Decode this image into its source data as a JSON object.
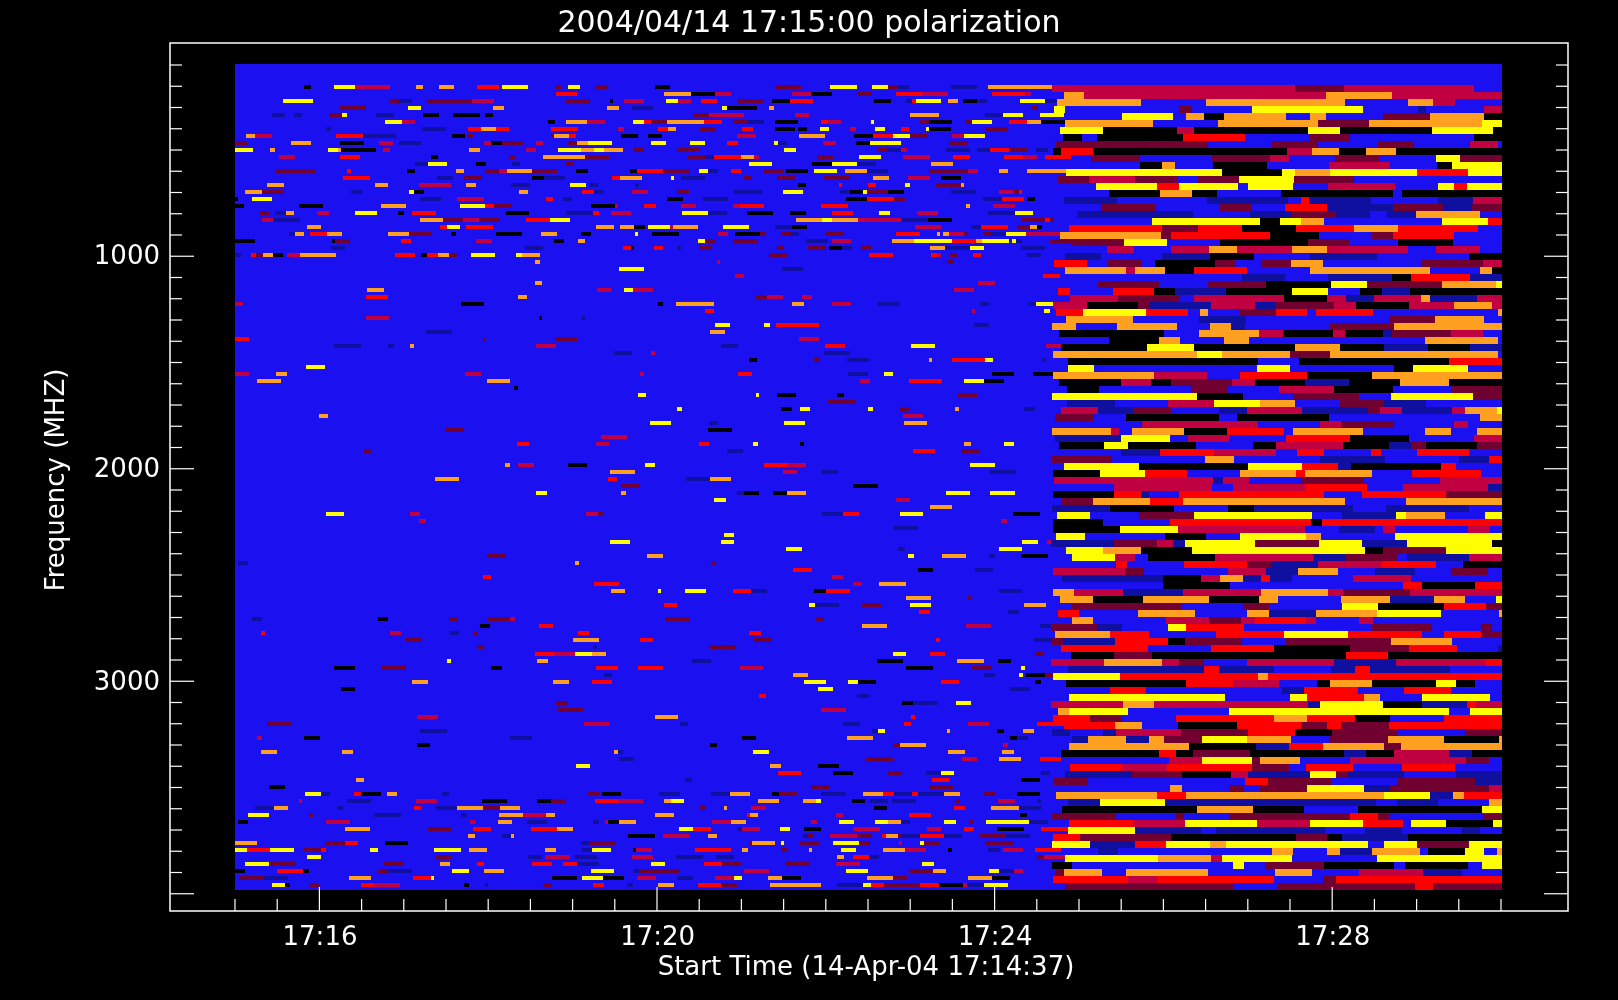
{
  "title": "2004/04/14 17:15:00 polarization",
  "y_axis": {
    "label": "Frequency (MHZ)",
    "ticks": [
      "1000",
      "2000",
      "3000"
    ]
  },
  "x_axis": {
    "label": "Start Time (14-Apr-04 17:14:37)",
    "ticks": [
      "17:16",
      "17:20",
      "17:24",
      "17:28"
    ]
  }
}
